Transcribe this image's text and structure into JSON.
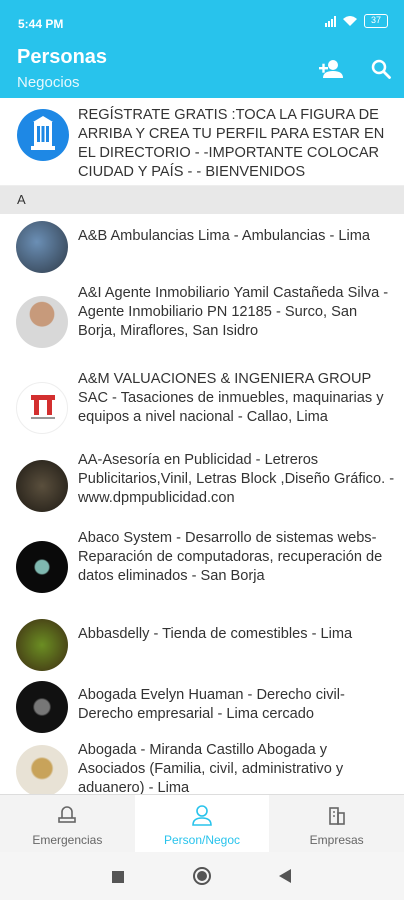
{
  "status_bar": {
    "time": "5:44 PM",
    "battery": "37"
  },
  "app_bar": {
    "title": "Personas",
    "subtitle": "Negocios",
    "add_person_icon": "person-add-icon",
    "search_icon": "search-icon"
  },
  "banner": {
    "text": "REGÍSTRATE GRATIS :TOCA LA FIGURA DE ARRIBA Y CREA TU PERFIL PARA ESTAR EN EL DIRECTORIO - -IMPORTANTE COLOCAR CIUDAD Y PAÍS - - BIENVENIDOS"
  },
  "section_header": "A",
  "items": [
    {
      "text": "A&B Ambulancias Lima - Ambulancias - Lima"
    },
    {
      "text": "A&I Agente Inmobiliario Yamil Castañeda Silva - Agente Inmobiliario PN 12185 - Surco, San Borja, Miraflores, San Isidro"
    },
    {
      "text": "A&M VALUACIONES & INGENIERA GROUP SAC - Tasaciones de inmuebles, maquinarias y equipos a nivel nacional - Callao, Lima"
    },
    {
      "text": "AA-Asesoría en Publicidad - Letreros Publicitarios,Vinil, Letras Block ,Diseño Gráfico. - www.dpmpublicidad.con"
    },
    {
      "text": "Abaco System - Desarrollo de sistemas webs- Reparación de computadoras, recuperación de datos eliminados - San Borja"
    },
    {
      "text": "Abbasdelly - Tienda de comestibles - Lima"
    },
    {
      "text": "Abogada Evelyn Huaman - Derecho civil- Derecho empresarial - Lima cercado"
    },
    {
      "text": "Abogada - Miranda Castillo Abogada y Asociados (Familia, civil, administrativo y aduanero) - Lima"
    }
  ],
  "bottom_nav": {
    "tabs": [
      {
        "label": "Emergencias",
        "icon": "emergency-light-icon"
      },
      {
        "label": "Person/Negoc",
        "icon": "person-icon"
      },
      {
        "label": "Empresas",
        "icon": "buildings-icon"
      }
    ]
  },
  "colors": {
    "primary": "#28c3ec",
    "banner_logo": "#1e88e5"
  }
}
